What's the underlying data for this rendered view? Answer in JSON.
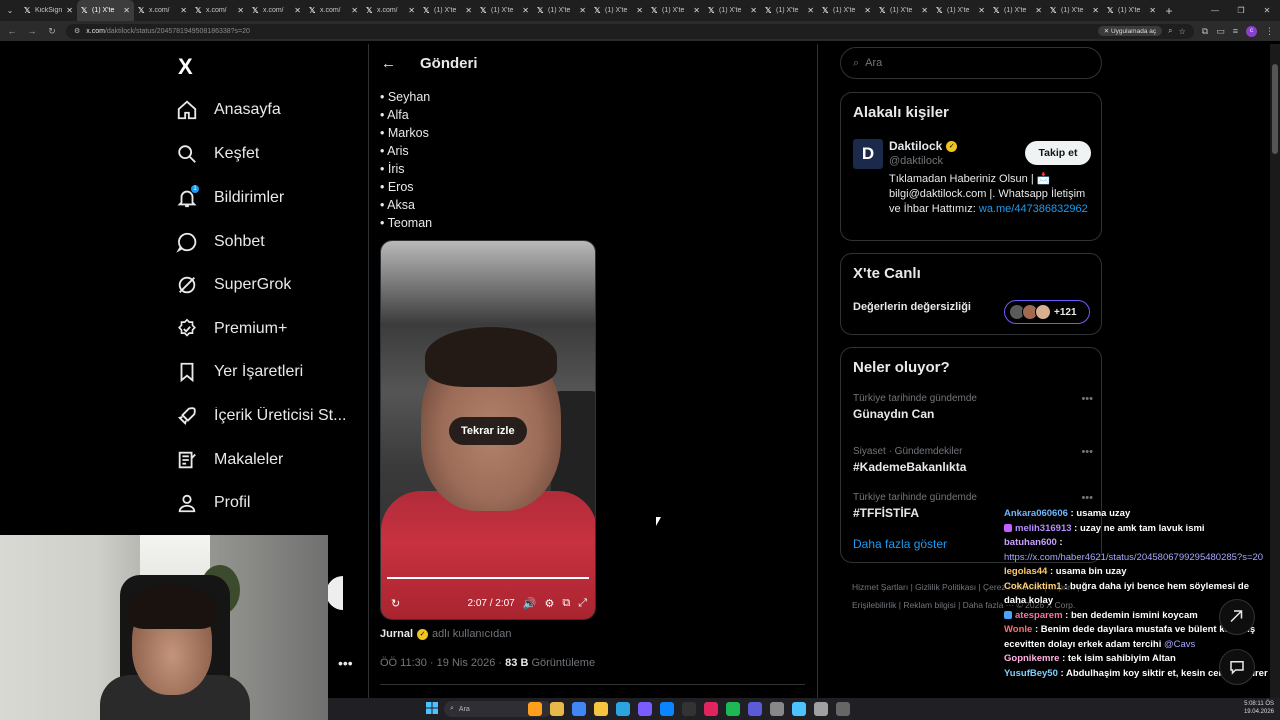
{
  "browser": {
    "tabs": [
      {
        "title": "KickSign",
        "active": false
      },
      {
        "title": "(1) X'te",
        "active": true
      },
      {
        "title": "x.com/",
        "active": false
      },
      {
        "title": "x.com/",
        "active": false
      },
      {
        "title": "x.com/",
        "active": false
      },
      {
        "title": "x.com/",
        "active": false
      },
      {
        "title": "x.com/",
        "active": false
      },
      {
        "title": "(1) X'te",
        "active": false
      },
      {
        "title": "(1) X'te",
        "active": false
      },
      {
        "title": "(1) X'te",
        "active": false
      },
      {
        "title": "(1) X'te",
        "active": false
      },
      {
        "title": "(1) X'te",
        "active": false
      },
      {
        "title": "(1) X'te",
        "active": false
      },
      {
        "title": "(1) X'te",
        "active": false
      },
      {
        "title": "(1) X'te",
        "active": false
      },
      {
        "title": "(1) X'te",
        "active": false
      },
      {
        "title": "(1) X'te",
        "active": false
      },
      {
        "title": "(1) X'te",
        "active": false
      },
      {
        "title": "(1) X'te",
        "active": false
      },
      {
        "title": "(1) X'te",
        "active": false
      }
    ],
    "url_host": "x.com",
    "url_path": "/daktilock/status/2045781949508186338?s=20",
    "open_in_app": "Uygulamada aç"
  },
  "sidebar": {
    "logo": "X",
    "items": [
      {
        "label": "Anasayfa",
        "icon": "home-icon"
      },
      {
        "label": "Keşfet",
        "icon": "search-icon"
      },
      {
        "label": "Bildirimler",
        "icon": "bell-icon"
      },
      {
        "label": "Sohbet",
        "icon": "chat-icon"
      },
      {
        "label": "SuperGrok",
        "icon": "grok-icon"
      },
      {
        "label": "Premium+",
        "icon": "premium-icon"
      },
      {
        "label": "Yer İşaretleri",
        "icon": "bookmark-icon"
      },
      {
        "label": "İçerik Üreticisi St...",
        "icon": "rocket-icon"
      },
      {
        "label": "Makaleler",
        "icon": "article-icon"
      },
      {
        "label": "Profil",
        "icon": "person-icon"
      }
    ],
    "notification_badge": "1",
    "more": "•••"
  },
  "post": {
    "back": "←",
    "header_title": "Gönderi",
    "bullets": [
      "• Seyhan",
      "• Alfa",
      "• Markos",
      "• Aris",
      "• İris",
      "• Eros",
      "• Aksa",
      "• Teoman"
    ],
    "video": {
      "replay_label": "Tekrar izle",
      "time": "2:07 / 2:07",
      "progress": 1.0
    },
    "author": "Jurnal",
    "author_suffix": "adlı kullanıcıdan",
    "time": "ÖÖ 11:30 · 19 Nis 2026 ·",
    "views": "83 B",
    "views_label": "Görüntüleme"
  },
  "right": {
    "search_placeholder": "Ara",
    "related": {
      "title": "Alakalı kişiler",
      "name": "Daktilock",
      "handle": "@daktilock",
      "follow": "Takip et",
      "bio": "Tıklamadan Haberiniz Olsun | 📩 bilgi@daktilock.com |. Whatsapp İletişim ve İhbar Hattımız:",
      "link": "wa.me/447386832962",
      "avatar_letter": "D"
    },
    "live": {
      "title": "X'te Canlı",
      "topic": "Değerlerin değersizliği",
      "count": "+121"
    },
    "trends": {
      "title": "Neler oluyor?",
      "items": [
        {
          "category": "Türkiye tarihinde gündemde",
          "name": "Günaydın Can"
        },
        {
          "category": "Siyaset · Gündemdekiler",
          "name": "#KademeBakanlıkta"
        },
        {
          "category": "Türkiye tarihinde gündemde",
          "name": "#TFFİSTİFA"
        }
      ],
      "show_more": "Daha fazla göster"
    },
    "footer": "Hizmet Şartları | Gizlilik Politikası | Çerez Politikası | Imprint | Erişilebilirlik | Reklam bilgisi | Daha fazla ··· © 2026 X Corp."
  },
  "chat": [
    {
      "user": "Ankara060606",
      "color": "#6fb7ff",
      "text": " : usama uzay"
    },
    {
      "user": "melih316913",
      "color": "#b58cff",
      "text": " : uzay ne amk tam lavuk ismi",
      "badge": "#c060ff"
    },
    {
      "user": "batuhan600",
      "color": "#c8a0ff",
      "text": " :",
      "link": "https://x.com/haber4621/status/2045806799295480285?s=20"
    },
    {
      "user": "legolas44",
      "color": "#ffcc66",
      "text": " : usama bin uzay"
    },
    {
      "user": "CokAciktim1",
      "color": "#ffd27a",
      "text": " : buğra daha iyi bence hem söylemesi de daha kolay"
    },
    {
      "user": "atesparem",
      "color": "#ff6fa8",
      "text": " : ben dedemin ismini koycam",
      "badge": "#4aa3ff"
    },
    {
      "user": "Wonle",
      "color": "#ff7070",
      "text": " : Benim dede dayılara mustafa ve bülent koymuş ecevitten dolayı erkek adam tercihi",
      "mention": "@Cavs"
    },
    {
      "user": "Gopnikemre",
      "color": "#ffb2e0",
      "text": " : tek isim sahibiyim Altan"
    },
    {
      "user": "YusufBey50",
      "color": "#7fd1ff",
      "text": " : Abdulhaşim koy siktir et, kesin cennete girer"
    }
  ],
  "taskbar": {
    "search": "Ara",
    "clock_time": "5:08:11 ÖS",
    "clock_date": "19.04.2026"
  }
}
